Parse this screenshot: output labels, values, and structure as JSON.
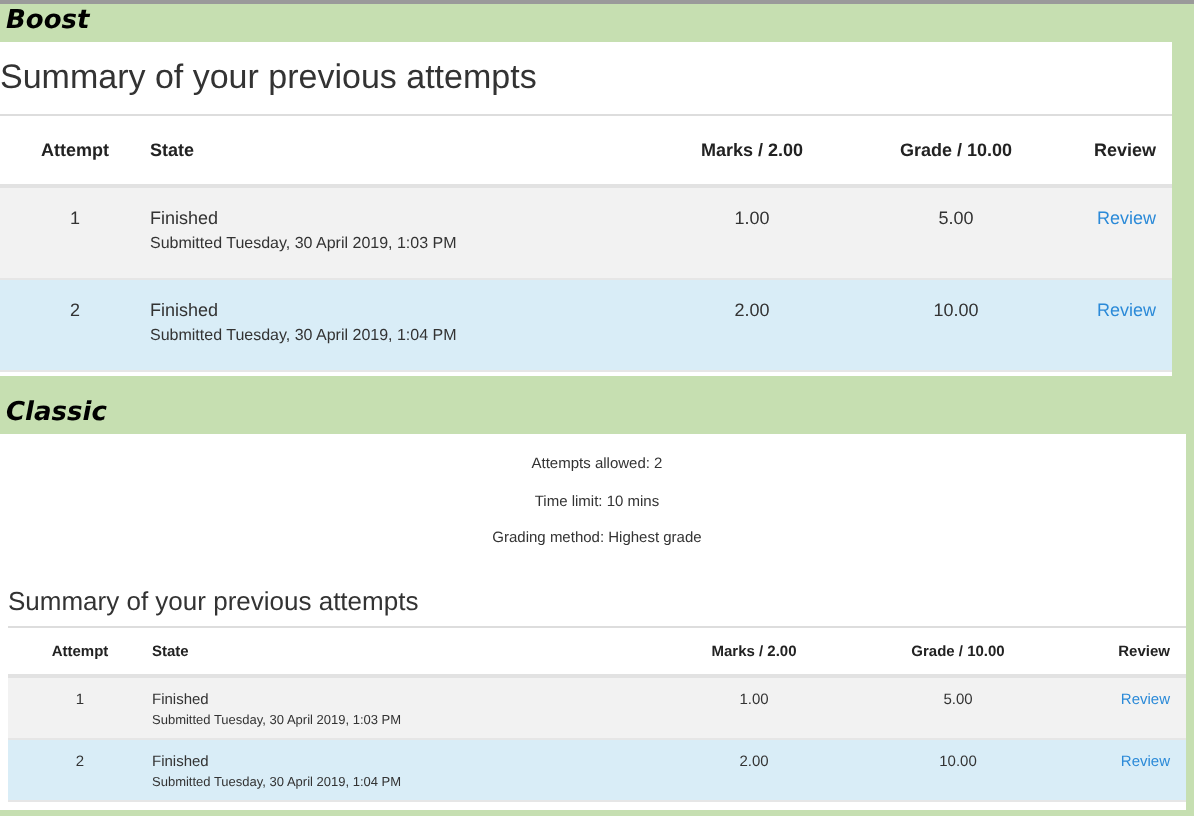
{
  "sections": [
    {
      "label": "Boost",
      "kind": "boost",
      "title": "Summary of your previous attempts",
      "columns": [
        "Attempt",
        "State",
        "Marks / 2.00",
        "Grade / 10.00",
        "Review"
      ],
      "rows": [
        {
          "attempt": "1",
          "state": "Finished",
          "submitted": "Submitted Tuesday, 30 April 2019, 1:03 PM",
          "marks": "1.00",
          "grade": "5.00",
          "review": "Review",
          "highlighted": false
        },
        {
          "attempt": "2",
          "state": "Finished",
          "submitted": "Submitted Tuesday, 30 April 2019, 1:04 PM",
          "marks": "2.00",
          "grade": "10.00",
          "review": "Review",
          "highlighted": true
        }
      ]
    },
    {
      "label": "Classic",
      "kind": "classic",
      "info": [
        "Attempts allowed: 2",
        "Time limit: 10 mins",
        "Grading method: Highest grade"
      ],
      "title": "Summary of your previous attempts",
      "columns": [
        "Attempt",
        "State",
        "Marks / 2.00",
        "Grade / 10.00",
        "Review"
      ],
      "rows": [
        {
          "attempt": "1",
          "state": "Finished",
          "submitted": "Submitted Tuesday, 30 April 2019, 1:03 PM",
          "marks": "1.00",
          "grade": "5.00",
          "review": "Review",
          "highlighted": false
        },
        {
          "attempt": "2",
          "state": "Finished",
          "submitted": "Submitted Tuesday, 30 April 2019, 1:04 PM",
          "marks": "2.00",
          "grade": "10.00",
          "review": "Review",
          "highlighted": true
        }
      ]
    }
  ]
}
